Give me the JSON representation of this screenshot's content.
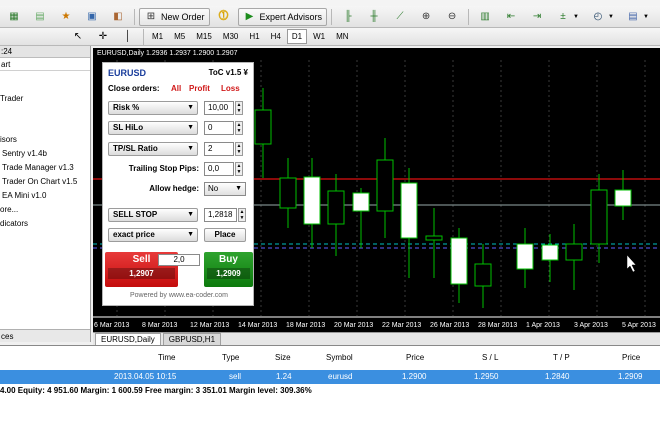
{
  "toolbar": {
    "new_order_label": "New Order",
    "expert_advisors_label": "Expert Advisors"
  },
  "timeframes": [
    "M1",
    "M5",
    "M15",
    "M30",
    "H1",
    "H4",
    "D1",
    "W1",
    "MN"
  ],
  "navigator": {
    "header": ":24",
    "header2": "art",
    "items": [
      "Trader",
      "isors",
      "Sentry v1.4b",
      "Trade Manager v1.3",
      "Trader On Chart v1.5",
      "EA Mini v1.0",
      "ore...",
      "dicators"
    ],
    "bottom_tab": "ces"
  },
  "chart": {
    "title": "EURUSD,Daily  1.2936 1.2937 1.2900 1.2907",
    "tabs": [
      "EURUSD,Daily",
      "GBPUSD,H1"
    ],
    "date_labels": [
      "6 Mar 2013",
      "8 Mar 2013",
      "12 Mar 2013",
      "14 Mar 2013",
      "18 Mar 2013",
      "20 Mar 2013",
      "22 Mar 2013",
      "26 Mar 2013",
      "28 Mar 2013",
      "1 Apr 2013",
      "3 Apr 2013",
      "5 Apr 2013"
    ]
  },
  "panel": {
    "symbol": "EURUSD",
    "version": "ToC v1.5 ¥",
    "close_orders_label": "Close orders:",
    "close_all": "All",
    "close_profit": "Profit",
    "close_loss": "Loss",
    "risk_label": "Risk %",
    "risk_value": "10,00",
    "sl_label": "SL HiLo",
    "sl_value": "0",
    "tpsl_label": "TP/SL Ratio",
    "tpsl_value": "2",
    "trailing_label": "Trailing Stop Pips:",
    "trailing_value": "0,0",
    "hedge_label": "Allow hedge:",
    "hedge_value": "No",
    "order_type": "SELL STOP",
    "order_price": "1,2818",
    "price_mode": "exact price",
    "place_label": "Place",
    "sell_label": "Sell",
    "sell_price": "1,2907",
    "spread": "2,0",
    "buy_label": "Buy",
    "buy_price": "1,2909",
    "powered": "Powered by www.ea-coder.com"
  },
  "terminal": {
    "columns": [
      "Time",
      "Type",
      "Size",
      "Symbol",
      "Price",
      "S / L",
      "T / P",
      "Price"
    ],
    "row": [
      "2013.04.05 10:15",
      "sell",
      "1.24",
      "eurusd",
      "1.2900",
      "1.2950",
      "1.2840",
      "1.2909"
    ],
    "balance_line": "4.00  Equity: 4 951.60   Margin: 1 600.59   Free margin: 3 351.01   Margin level: 309.36%"
  },
  "colors": {
    "sell": "#d01818",
    "buy": "#1a8c1a",
    "selected_row": "#3b8fe0",
    "candle_outline": "#00c000"
  }
}
